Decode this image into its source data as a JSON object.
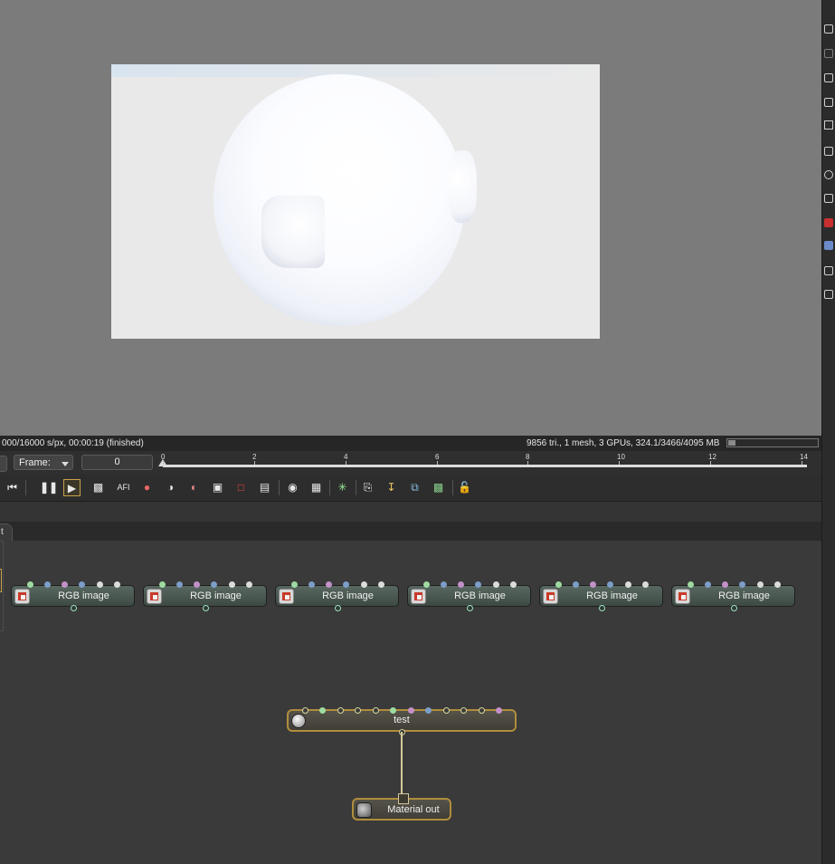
{
  "render_status": {
    "left": "000/16000 s/px, 00:00:19 (finished)",
    "right": "9856 tri., 1 mesh, 3 GPUs, 324.1/3466/4095 MB",
    "memory_fraction": 0.08
  },
  "timeline": {
    "frame_label": "Frame:",
    "frame_value": "0",
    "ticks": [
      "0",
      "2",
      "4",
      "6",
      "8",
      "10",
      "12",
      "14"
    ]
  },
  "toolbar": {
    "icons": [
      "skip-back-icon",
      "pause-icon",
      "play-icon",
      "display-icon",
      "afi-icon",
      "color-wheel-icon",
      "denoise-icon",
      "render-pass-icon",
      "region-icon",
      "stop-region-icon",
      "camera-pick-icon",
      "zoom-icon",
      "checker-icon",
      "gauge-icon",
      "clipboard-icon",
      "export-icon",
      "copy-icon",
      "image-icon",
      "lock-icon"
    ],
    "afi_label": "AFI"
  },
  "graph": {
    "tab_label": "t",
    "rgb_nodes": [
      {
        "label": "RGB image"
      },
      {
        "label": "RGB image"
      },
      {
        "label": "RGB image"
      },
      {
        "label": "RGB image"
      },
      {
        "label": "RGB image"
      },
      {
        "label": "RGB image"
      }
    ],
    "material_node": {
      "label": "test"
    },
    "output_node": {
      "label": "Material out"
    }
  }
}
